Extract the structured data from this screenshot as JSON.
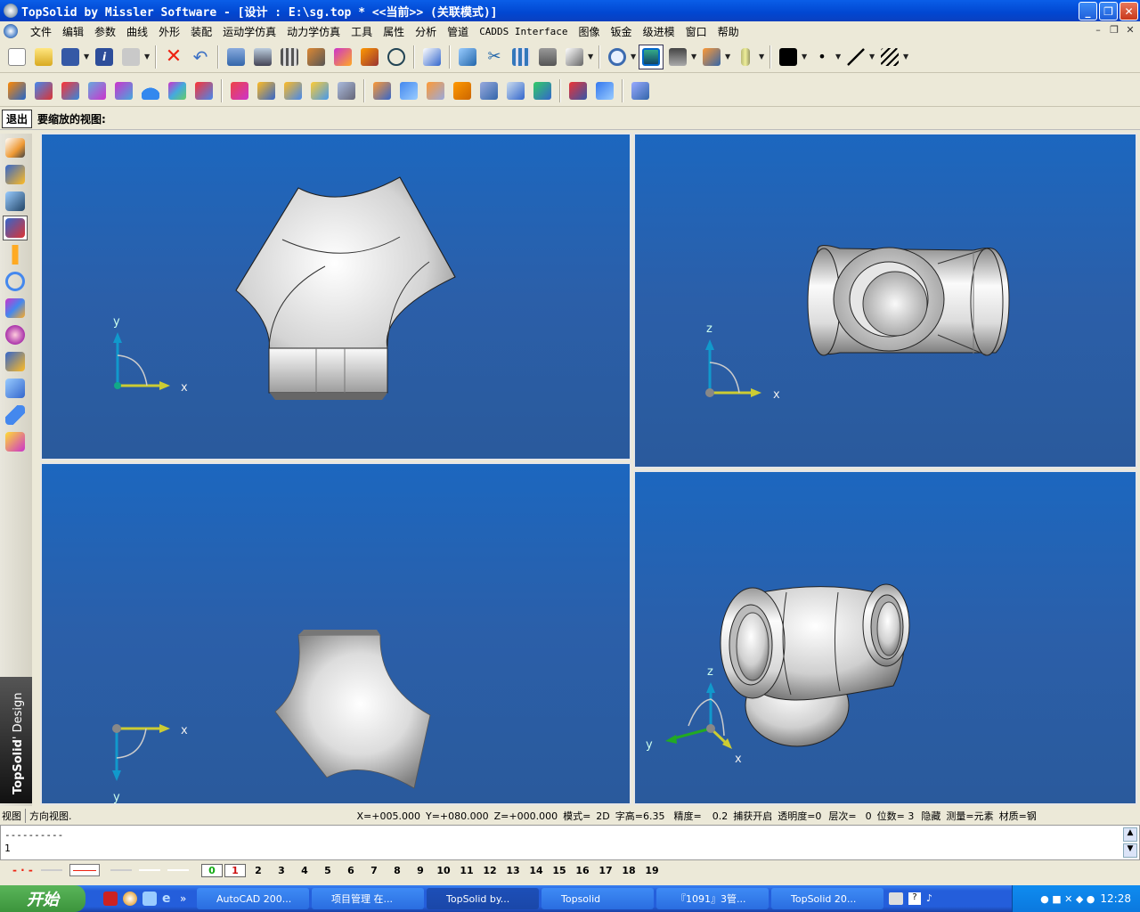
{
  "window": {
    "title": "TopSolid by Missler Software - [设计 : E:\\sg.top *  <<当前>> (关联模式)]"
  },
  "menu": [
    "文件",
    "编辑",
    "参数",
    "曲线",
    "外形",
    "装配",
    "运动学仿真",
    "动力学仿真",
    "工具",
    "属性",
    "分析",
    "管道",
    "CADDS Interface",
    "图像",
    "钣金",
    "级进模",
    "窗口",
    "帮助"
  ],
  "prompt": {
    "exit_label": "退出",
    "text": "要缩放的视图:"
  },
  "brand": {
    "name": "TopSolid",
    "suffix": "' Design"
  },
  "viewports": [
    {
      "name": "top",
      "axes": [
        "y",
        "x"
      ]
    },
    {
      "name": "front",
      "axes": [
        "z",
        "x"
      ]
    },
    {
      "name": "bottom",
      "axes": [
        "x",
        "y"
      ]
    },
    {
      "name": "iso",
      "axes": [
        "z",
        "y",
        "x"
      ]
    }
  ],
  "status": {
    "mode": "视图",
    "hint": "方向视图.",
    "x": "X=+005.000",
    "y": "Y=+080.000",
    "z": "Z=+000.000",
    "model": "模式=",
    "model_val": "2D",
    "char_height": "字高=6.35",
    "precision": "精度=",
    "precision_val": "0.2",
    "snap": "捕获开启",
    "transparency": "透明度=0",
    "layer": "层次=",
    "layer_val": "0",
    "digits": "位数= 3",
    "hidden": "隐藏",
    "measure": "测量=元素",
    "material": "材质=钢"
  },
  "command": {
    "line1": "----------",
    "line2": "1"
  },
  "layers": [
    "0",
    "1",
    "2",
    "3",
    "4",
    "5",
    "6",
    "7",
    "8",
    "9",
    "10",
    "11",
    "12",
    "13",
    "14",
    "15",
    "16",
    "17",
    "18",
    "19"
  ],
  "taskbar": {
    "start": "开始",
    "tasks": [
      "AutoCAD 200...",
      "项目管理 在...",
      "TopSolid by...",
      "Topsolid",
      "『1091』3管...",
      "TopSolid 20..."
    ],
    "clock": "12:28"
  }
}
